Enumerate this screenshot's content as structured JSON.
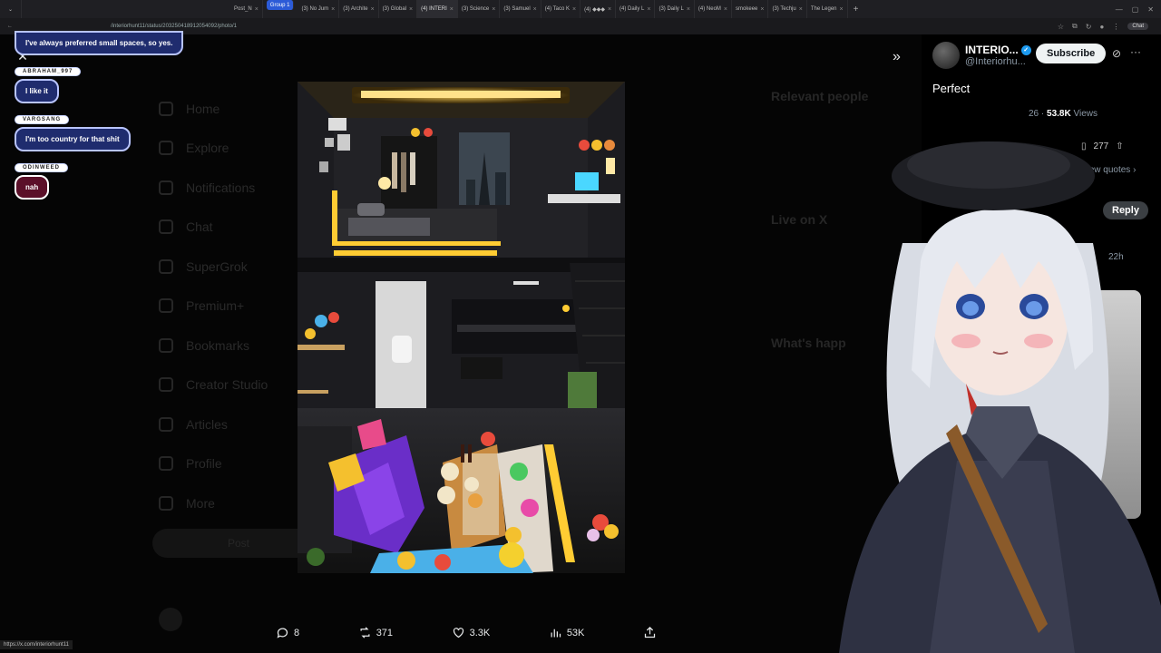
{
  "browser": {
    "tabs": [
      {
        "label": "Post_N",
        "close": "×"
      },
      {
        "label": "Group 1",
        "close": ""
      },
      {
        "label": "(3) No Jum",
        "close": "×"
      },
      {
        "label": "(3) Archite",
        "close": "×"
      },
      {
        "label": "(3) Global",
        "close": "×"
      },
      {
        "label": "(4) INTERI",
        "close": "×"
      },
      {
        "label": "(3) Science",
        "close": "×"
      },
      {
        "label": "(3) Samuel",
        "close": "×"
      },
      {
        "label": "(4) Taco K",
        "close": "×"
      },
      {
        "label": "(4) ◆◆◆",
        "close": "×"
      },
      {
        "label": "(4) Daily L",
        "close": "×"
      },
      {
        "label": "(3) Daily L",
        "close": "×"
      },
      {
        "label": "(4) NeoM",
        "close": "×"
      },
      {
        "label": "smokeee",
        "close": "×"
      },
      {
        "label": "(3) Techju",
        "close": "×"
      },
      {
        "label": "The Legen",
        "close": "×"
      }
    ],
    "new_tab": "+",
    "url": "/interiorhunt11/status/203250418912054092/photo/1",
    "chat_chip": "Chat"
  },
  "dim_nav": [
    "Home",
    "Explore",
    "Notifications",
    "Chat",
    "SuperGrok",
    "Premium+",
    "Bookmarks",
    "Creator Studio",
    "Articles",
    "Profile",
    "More"
  ],
  "dim_post_button": "Post",
  "dim_right": [
    "Relevant people",
    "Live on X",
    "What's happ"
  ],
  "viewer": {
    "close_icon": "✕",
    "expand_icon": "»",
    "actions": {
      "replies": "8",
      "reposts": "371",
      "likes": "3.3K",
      "views": "53K"
    }
  },
  "side_panel": {
    "name": "INTERIO...",
    "handle": "@Interiorhu...",
    "subscribe": "Subscribe",
    "tweet": "Perfect",
    "time": "26",
    "views_count": "53.8K",
    "views_label": "Views",
    "bookmarks": "277",
    "quotes_label": "View quotes ›",
    "reply_button": "Reply",
    "timestamp": "22h",
    "badge": "7"
  },
  "chat": [
    {
      "user": "",
      "message": "I've always preferred small spaces, so yes.",
      "top": true
    },
    {
      "user": "ABRAHAM_997",
      "message": "I like it"
    },
    {
      "user": "VARGSANG",
      "message": "I'm too country for that shit"
    },
    {
      "user": "ODINWEED",
      "message": "nah",
      "red": true
    }
  ],
  "status_url": "https://x.com/interiorhunt11",
  "colors": {
    "accent": "#1d9bf0",
    "chat_bubble": "#1f2c6e",
    "chat_bubble_red": "#5b1029",
    "led": "#ffc83a"
  }
}
